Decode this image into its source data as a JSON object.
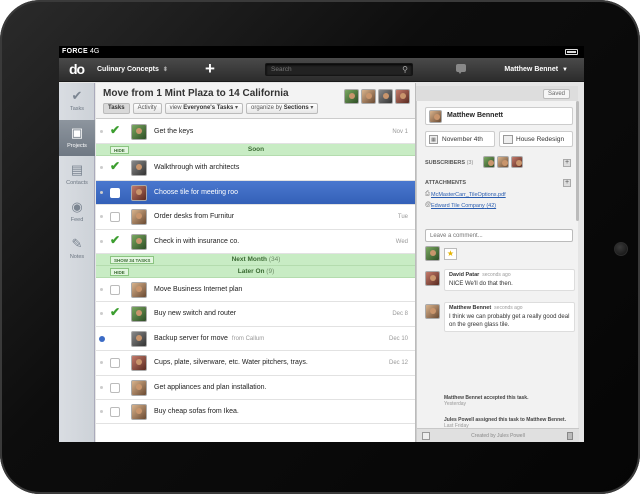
{
  "status_bar": {
    "carrier": "FORCE",
    "network": "4G"
  },
  "top_bar": {
    "logo": "do",
    "workspace": "Culinary Concepts",
    "search_placeholder": "Search",
    "user": "Matthew Bennet"
  },
  "sidebar": {
    "items": [
      {
        "label": "Tasks",
        "icon": "checkmark-icon"
      },
      {
        "label": "Projects",
        "icon": "folder-check-icon",
        "active": true
      },
      {
        "label": "Contacts",
        "icon": "contacts-icon"
      },
      {
        "label": "Feed",
        "icon": "feed-icon"
      },
      {
        "label": "Notes",
        "icon": "pencil-icon"
      }
    ]
  },
  "project": {
    "title": "Move from 1 Mint Plaza to 14 California",
    "tabs": [
      "Tasks",
      "Activity"
    ],
    "view_prefix": "view",
    "view_value": "Everyone's Tasks",
    "organize_prefix": "organize by",
    "organize_value": "Sections"
  },
  "tasks": [
    {
      "type": "task",
      "done": true,
      "name": "Get the keys",
      "date": "Nov 1"
    },
    {
      "type": "section",
      "tag": "HIDE",
      "name": "Soon",
      "count": ""
    },
    {
      "type": "task",
      "done": true,
      "name": "Walkthrough with architects",
      "date": ""
    },
    {
      "type": "task",
      "done": false,
      "selected": true,
      "name": "Choose tile for meeting roo",
      "date": ""
    },
    {
      "type": "task",
      "done": false,
      "name": "Order desks from Furnitur",
      "date": "Tue"
    },
    {
      "type": "task",
      "done": true,
      "name": "Check in with insurance co.",
      "date": "Wed"
    },
    {
      "type": "section",
      "tag": "SHOW 34 TASKS",
      "name": "Next Month",
      "count": "(34)"
    },
    {
      "type": "section",
      "tag": "HIDE",
      "name": "Later On",
      "count": "(9)"
    },
    {
      "type": "task",
      "done": false,
      "name": "Move Business Internet plan",
      "date": ""
    },
    {
      "type": "task",
      "done": true,
      "name": "Buy new switch and router",
      "date": "Dec 8"
    },
    {
      "type": "task",
      "done": false,
      "dot": "blue",
      "name": "Backup server for move",
      "from": "from Callum",
      "date": "Dec 10"
    },
    {
      "type": "task",
      "done": false,
      "name": "Cups, plate, silverware, etc. Water pitchers, trays.",
      "date": "Dec 12"
    },
    {
      "type": "task",
      "done": false,
      "name": "Get appliances and plan installation.",
      "date": ""
    },
    {
      "type": "task",
      "done": false,
      "name": "Buy cheap sofas from Ikea.",
      "date": ""
    }
  ],
  "detail": {
    "saved_label": "Saved",
    "owner": "Matthew Bennett",
    "due": "November 4th",
    "project": "House Redesign",
    "subscribers_label": "SUBSCRIBERS",
    "subscribers_count": "(3)",
    "attachments_label": "ATTACHMENTS",
    "attachments": [
      {
        "name": "McMasterCarr_TileOptions.pdf",
        "icon": "paperclip-icon"
      },
      {
        "name": "Edward Tile Company",
        "count": "(42)",
        "icon": "link-icon"
      }
    ],
    "comment_placeholder": "Leave a comment...",
    "comments": [
      {
        "author": "David Patar",
        "time": "seconds ago",
        "text": "NICE We'll do that then."
      },
      {
        "author": "Matthew Bennet",
        "time": "seconds ago",
        "text": "I think we can probably get a really good deal on the green glass tile."
      }
    ],
    "activity": [
      {
        "text": "Matthew Bennet accepted this task.",
        "time": "Yesterday"
      },
      {
        "text": "Jules Powell assigned this task to Matthew Bennet.",
        "time": "Last Friday"
      }
    ],
    "created_by": "Created by Jules Powell"
  }
}
